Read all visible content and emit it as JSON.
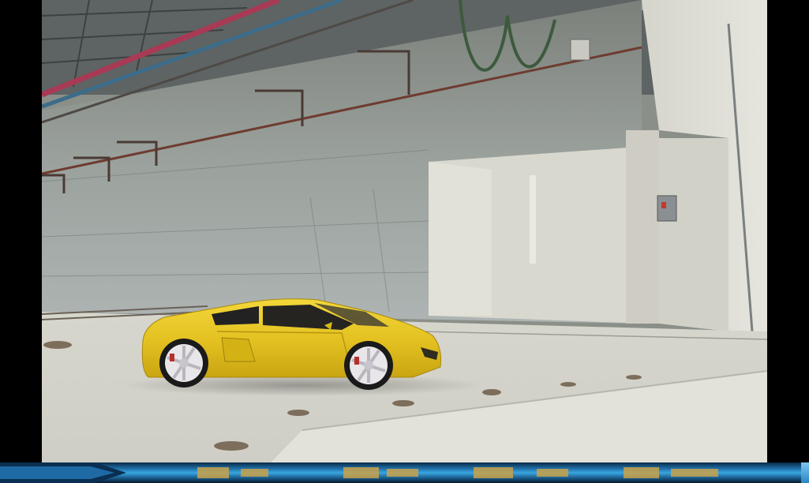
{
  "scene": {
    "description_icon": "car-render-viewport-icon",
    "car_color": "#e8c51a",
    "wheel_color": "#e9e6ea",
    "wall_color": "#8d938c",
    "floor_color": "#d9d7ce"
  },
  "bottom_bar": {
    "icon": "progress-indicator-icon",
    "accent": "#3aa6e0"
  }
}
